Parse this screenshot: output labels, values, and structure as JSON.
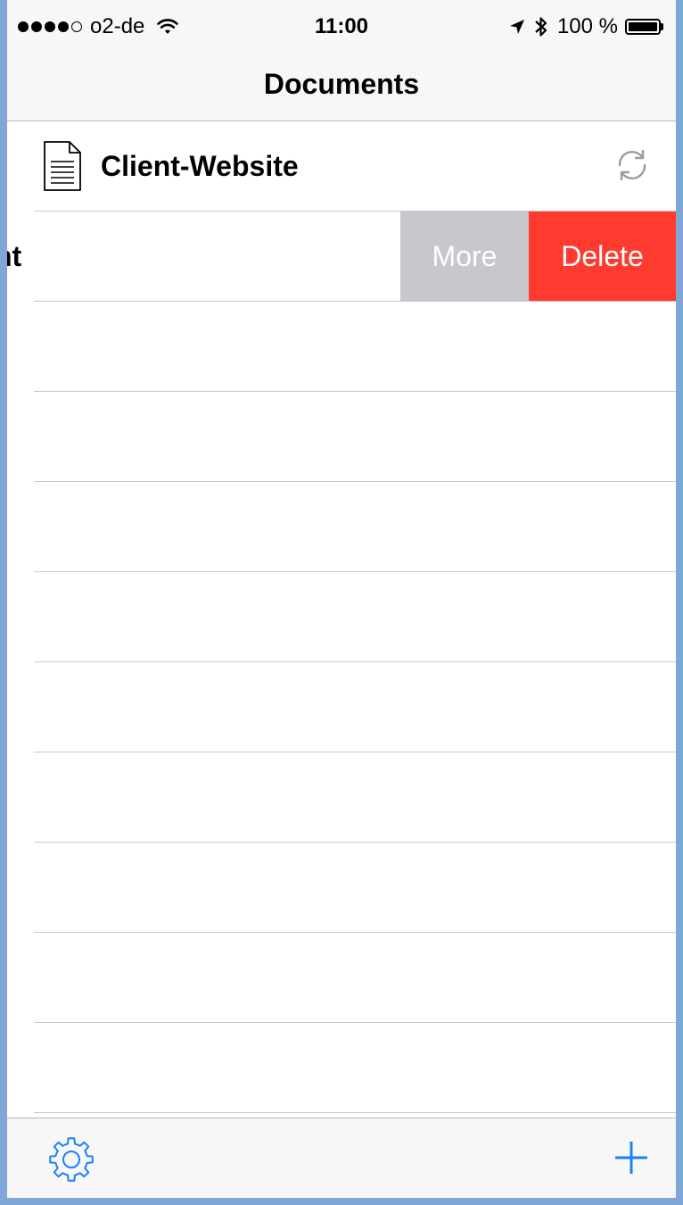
{
  "status_bar": {
    "carrier": "o2-de",
    "signal_dots_filled": 4,
    "signal_dots_total": 5,
    "time": "11:00",
    "battery_percent": "100 %",
    "icons": [
      "wifi-icon",
      "location-arrow-icon",
      "bluetooth-icon",
      "battery-icon"
    ]
  },
  "nav": {
    "title": "Documents"
  },
  "documents": [
    {
      "title": "Client-Website",
      "icon": "document-icon",
      "status_icon": "sync-icon"
    },
    {
      "title": "nt",
      "swiped": true
    }
  ],
  "swipe_actions": {
    "more_label": "More",
    "delete_label": "Delete"
  },
  "toolbar": {
    "settings_icon": "gear-icon",
    "add_icon": "plus-icon"
  },
  "colors": {
    "accent": "#1a82fb",
    "delete": "#ff3b30",
    "more": "#c7c7cc",
    "bar_background": "#f7f7f7",
    "separator": "#c8c7cc"
  }
}
